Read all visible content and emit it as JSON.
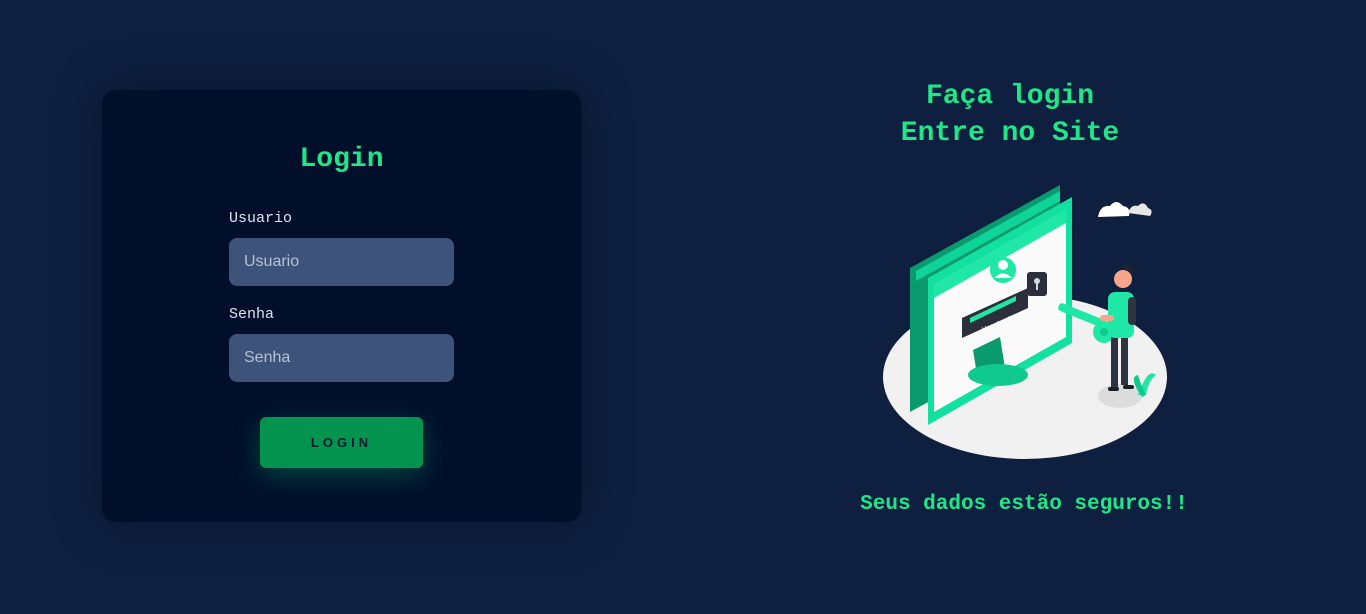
{
  "login_form": {
    "title": "Login",
    "username": {
      "label": "Usuario",
      "placeholder": "Usuario",
      "value": ""
    },
    "password": {
      "label": "Senha",
      "placeholder": "Senha",
      "value": ""
    },
    "submit_label": "LOGIN"
  },
  "hero": {
    "title_line1": "Faça login",
    "title_line2": "Entre no Site",
    "illustration": {
      "icon": "computer-user-login-illustration",
      "screen_button_text": "User Login"
    },
    "tagline": "Seus dados estão seguros!!"
  },
  "colors": {
    "background": "#0e1f40",
    "card": "#010f2b",
    "accent": "#1fe687",
    "input": "#3e5379",
    "button": "#049450"
  }
}
